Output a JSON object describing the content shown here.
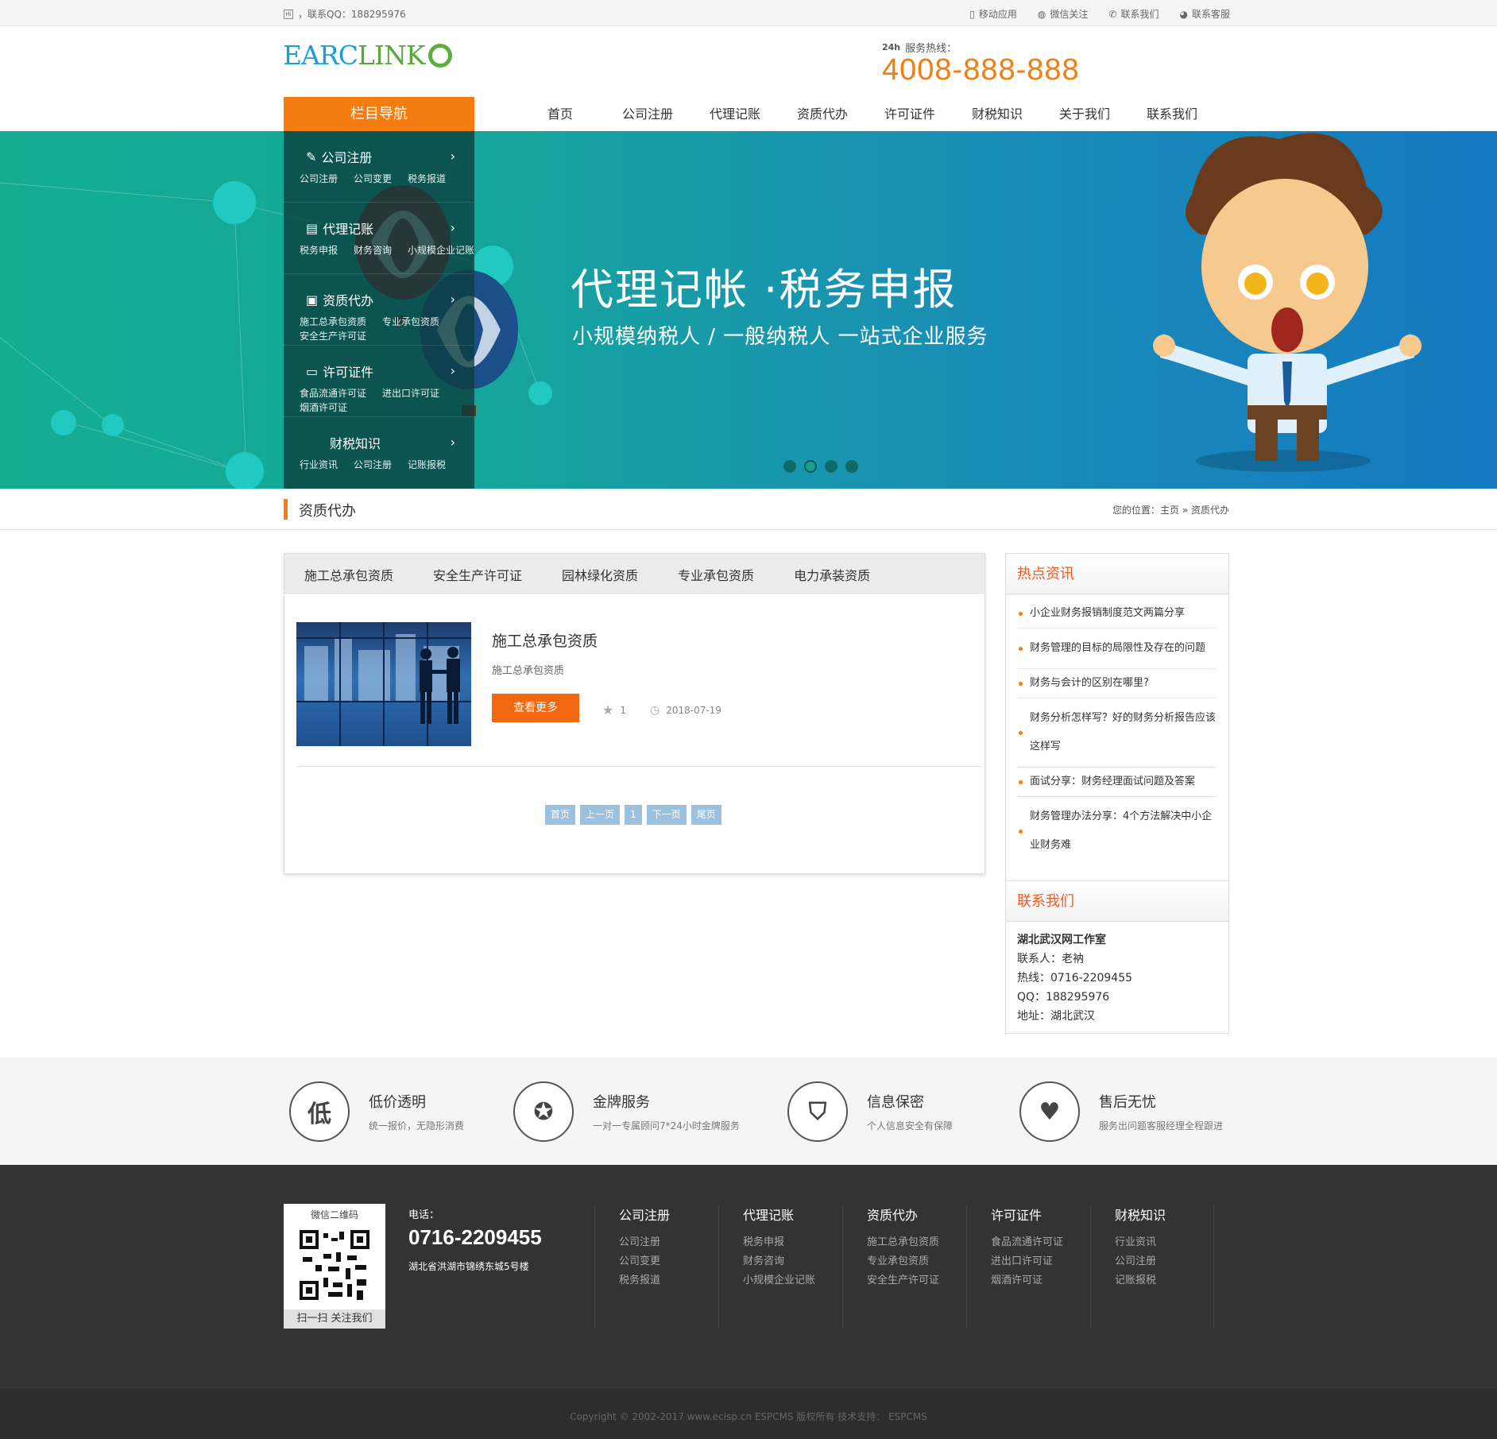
{
  "topbar": {
    "qq": "，联系QQ：188295976",
    "links": [
      "移动应用",
      "微信关注",
      "联系我们",
      "联系客服"
    ]
  },
  "logo": {
    "a": "EARC",
    "b": "LINK"
  },
  "hotline": {
    "label": "服务热线：",
    "number": "4008-888-888"
  },
  "nav": {
    "head": "栏目导航",
    "items": [
      "首页",
      "公司注册",
      "代理记账",
      "资质代办",
      "许可证件",
      "财税知识",
      "关于我们",
      "联系我们"
    ]
  },
  "sidenav": [
    {
      "title": "公司注册",
      "subs": [
        "公司注册",
        "公司变更",
        "税务报道"
      ]
    },
    {
      "title": "代理记账",
      "subs": [
        "税务申报",
        "财务咨询",
        "小规模企业记账"
      ]
    },
    {
      "title": "资质代办",
      "subs": [
        "施工总承包资质",
        "专业承包资质",
        "安全生产许可证"
      ]
    },
    {
      "title": "许可证件",
      "subs": [
        "食品流通许可证",
        "进出口许可证",
        "烟酒许可证"
      ]
    },
    {
      "title": "财税知识",
      "subs": [
        "行业资讯",
        "公司注册",
        "记账报税"
      ]
    }
  ],
  "banner": {
    "title": "代理记帐 ·税务申报",
    "subtitle": "小规模纳税人 / 一般纳税人  一站式企业服务"
  },
  "crumb": {
    "title": "资质代办",
    "pos": "您的位置：主页 » 资质代办"
  },
  "tabs": [
    "施工总承包资质",
    "安全生产许可证",
    "园林绿化资质",
    "专业承包资质",
    "电力承装资质"
  ],
  "item": {
    "title": "施工总承包资质",
    "desc": "施工总承包资质",
    "more": "查看更多",
    "count": "1",
    "date": "2018-07-19"
  },
  "pager": [
    "首页",
    "上一页",
    "1",
    "下一页",
    "尾页"
  ],
  "hot": {
    "title": "热点资讯",
    "items": [
      "小企业财务报销制度范文两篇分享",
      "财务管理的目标的局限性及存在的问题",
      "财务与会计的区别在哪里?",
      "财务分析怎样写？好的财务分析报告应该这样写",
      "面试分享：财务经理面试问题及答案",
      "财务管理办法分享：4个方法解决中小企业财务难"
    ]
  },
  "contact": {
    "title": "联系我们",
    "company": "湖北武汉网工作室",
    "person": "联系人：老衲",
    "tel": "热线：0716-2209455",
    "qq": "QQ：188295976",
    "addr": "地址：湖北武汉"
  },
  "features": [
    {
      "icon": "低",
      "title": "低价透明",
      "desc": "统一报价，无隐形消费"
    },
    {
      "icon": "",
      "title": "金牌服务",
      "desc": "一对一专属顾问7*24小时金牌服务"
    },
    {
      "icon": "",
      "title": "信息保密",
      "desc": "个人信息安全有保障"
    },
    {
      "icon": "",
      "title": "售后无忧",
      "desc": "服务出问题客服经理全程跟进"
    }
  ],
  "footer": {
    "qr_title": "微信二维码",
    "qr_caption": "扫一扫 关注我们",
    "tel_label": "电话：",
    "tel": "0716-2209455",
    "addr": "湖北省洪湖市锦绣东城5号楼",
    "cols": [
      {
        "h": "公司注册",
        "l": [
          "公司注册",
          "公司变更",
          "税务报道"
        ]
      },
      {
        "h": "代理记账",
        "l": [
          "税务申报",
          "财务咨询",
          "小规模企业记账"
        ]
      },
      {
        "h": "资质代办",
        "l": [
          "施工总承包资质",
          "专业承包资质",
          "安全生产许可证"
        ]
      },
      {
        "h": "许可证件",
        "l": [
          "食品流通许可证",
          "进出口许可证",
          "烟酒许可证"
        ]
      },
      {
        "h": "财税知识",
        "l": [
          "行业资讯",
          "公司注册",
          "记账报税"
        ]
      }
    ],
    "copyright": "Copyright © 2002-2017 www.ecisp.cn ESPCMS 版权所有 技术支持： ESPCMS"
  },
  "colors": {
    "accent": "#f47c10",
    "link_red": "#f15a22",
    "banner_start": "#14ad91",
    "banner_end": "#1479c2",
    "footer": "#333333"
  }
}
